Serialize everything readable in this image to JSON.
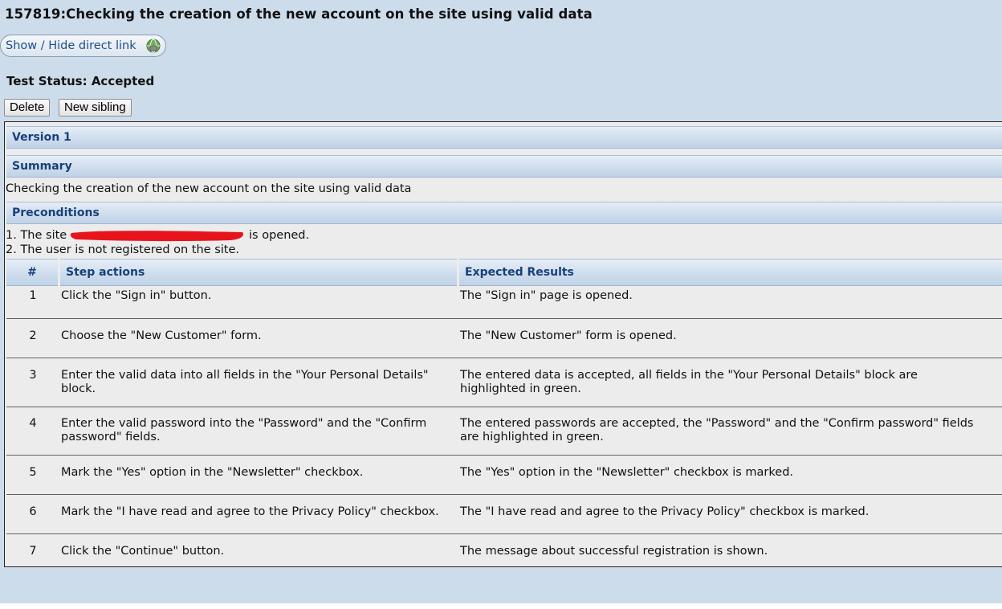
{
  "title": "157819:Checking the creation of the new account on the site using valid data",
  "direct_link_label": "Show / Hide direct link",
  "test_status": "Test Status: Accepted",
  "buttons": {
    "delete": "Delete",
    "new_sibling": "New sibling"
  },
  "sections": {
    "version": "Version 1",
    "summary_header": "Summary",
    "summary_text": "Checking the creation of the new account on the site using valid data",
    "preconditions_header": "Preconditions",
    "precondition_1_prefix": "1. The site",
    "precondition_1_suffix": "is opened.",
    "precondition_2": "2. The user is not registered on the site."
  },
  "steps_table": {
    "headers": {
      "num": "#",
      "actions": "Step actions",
      "expected": "Expected Results"
    },
    "rows": [
      {
        "num": "1",
        "action": "Click the \"Sign in\" button.",
        "expected": "The \"Sign in\" page is opened."
      },
      {
        "num": "2",
        "action": "Choose the \"New Customer\" form.",
        "expected": "The \"New Customer\" form is opened."
      },
      {
        "num": "3",
        "action": "Enter the valid data into all fields in the \"Your Personal Details\" block.",
        "expected": "The entered data is accepted, all fields in the \"Your Personal Details\" block are highlighted in green."
      },
      {
        "num": "4",
        "action": "Enter the valid password into the \"Password\" and the \"Confirm password\" fields.",
        "expected": "The entered passwords are  accepted, the \"Password\" and the \"Confirm password\" fields are highlighted in green."
      },
      {
        "num": "5",
        "action": "Mark the \"Yes\" option in the \"Newsletter\" checkbox.",
        "expected": "The \"Yes\" option in the \"Newsletter\" checkbox is marked."
      },
      {
        "num": "6",
        "action": "Mark the \"I have read and agree to the Privacy Policy\" checkbox.",
        "expected": "The \"I have read and agree to the Privacy Policy\" checkbox is marked."
      },
      {
        "num": "7",
        "action": "Click the \"Continue\" button.",
        "expected": "The message about successful registration is shown."
      }
    ]
  },
  "colors": {
    "page_bg": "#cddceb",
    "header_text": "#19407a",
    "panel_bg": "#ececec",
    "redaction": "#e8141c"
  },
  "icons": {
    "direct_link": "globe-icon"
  }
}
